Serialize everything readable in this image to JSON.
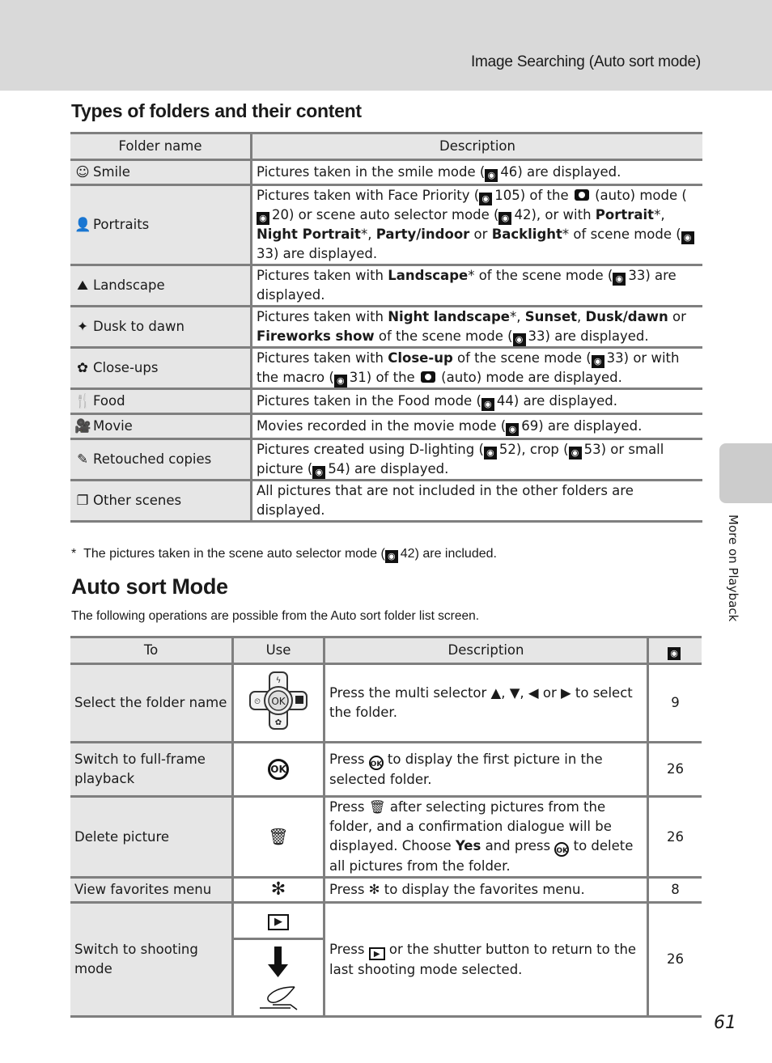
{
  "header": {
    "running_title": "Image Searching (Auto sort mode)"
  },
  "side_tab": {
    "label": "More on Playback"
  },
  "folders_section": {
    "title": "Types of folders and their content",
    "columns": [
      "Folder name",
      "Description"
    ],
    "rows": [
      {
        "icon": "smile-icon",
        "icon_glyph": "☺",
        "name": "Smile",
        "parts": [
          {
            "t": "Pictures taken in the smile mode ("
          },
          {
            "ref": "46"
          },
          {
            "t": ") are displayed."
          }
        ]
      },
      {
        "icon": "portrait-icon",
        "icon_glyph": "👤",
        "name": "Portraits",
        "parts": [
          {
            "t": "Pictures taken with Face Priority ("
          },
          {
            "ref": "105"
          },
          {
            "t": ") of the "
          },
          {
            "cam": true
          },
          {
            "t": " (auto) mode ("
          },
          {
            "ref": "20"
          },
          {
            "t": ") or scene auto selector mode ("
          },
          {
            "ref": "42"
          },
          {
            "t": "), or with "
          },
          {
            "b": "Portrait"
          },
          {
            "t": "*, "
          },
          {
            "b": "Night Portrait"
          },
          {
            "t": "*, "
          },
          {
            "b": "Party/indoor"
          },
          {
            "t": " or "
          },
          {
            "b": "Backlight"
          },
          {
            "t": "* of scene mode ("
          },
          {
            "ref": "33"
          },
          {
            "t": ") are displayed."
          }
        ]
      },
      {
        "icon": "landscape-icon",
        "icon_glyph": "⛰",
        "name": "Landscape",
        "parts": [
          {
            "t": "Pictures taken with "
          },
          {
            "b": "Landscape"
          },
          {
            "t": "* of the scene mode ("
          },
          {
            "ref": "33"
          },
          {
            "t": ") are displayed."
          }
        ]
      },
      {
        "icon": "dusk-to-dawn-icon",
        "icon_glyph": "✦",
        "name": "Dusk to dawn",
        "parts": [
          {
            "t": "Pictures taken with "
          },
          {
            "b": "Night landscape"
          },
          {
            "t": "*, "
          },
          {
            "b": "Sunset"
          },
          {
            "t": ", "
          },
          {
            "b": "Dusk/dawn"
          },
          {
            "t": " or "
          },
          {
            "b": "Fireworks show"
          },
          {
            "t": " of the scene mode ("
          },
          {
            "ref": "33"
          },
          {
            "t": ") are displayed."
          }
        ]
      },
      {
        "icon": "close-up-icon",
        "icon_glyph": "✿",
        "name": "Close-ups",
        "parts": [
          {
            "t": "Pictures taken with "
          },
          {
            "b": "Close-up"
          },
          {
            "t": " of the scene mode ("
          },
          {
            "ref": "33"
          },
          {
            "t": ") or with the macro ("
          },
          {
            "ref": "31"
          },
          {
            "t": ") of the "
          },
          {
            "cam": true
          },
          {
            "t": " (auto) mode are displayed."
          }
        ]
      },
      {
        "icon": "food-icon",
        "icon_glyph": "🍴",
        "name": "Food",
        "parts": [
          {
            "t": "Pictures taken in the Food mode ("
          },
          {
            "ref": "44"
          },
          {
            "t": ") are displayed."
          }
        ]
      },
      {
        "icon": "movie-icon",
        "icon_glyph": "🎥",
        "name": "Movie",
        "parts": [
          {
            "t": "Movies recorded in the movie mode ("
          },
          {
            "ref": "69"
          },
          {
            "t": ") are displayed."
          }
        ]
      },
      {
        "icon": "retouch-icon",
        "icon_glyph": "✎",
        "name": "Retouched copies",
        "parts": [
          {
            "t": "Pictures created using D-lighting ("
          },
          {
            "ref": "52"
          },
          {
            "t": "), crop ("
          },
          {
            "ref": "53"
          },
          {
            "t": ") or small picture ("
          },
          {
            "ref": "54"
          },
          {
            "t": ") are displayed."
          }
        ]
      },
      {
        "icon": "other-scenes-icon",
        "icon_glyph": "❐",
        "name": "Other scenes",
        "parts": [
          {
            "t": "All pictures that are not included in the other folders are displayed."
          }
        ]
      }
    ],
    "footnote_mark": "*",
    "footnote_parts": [
      {
        "t": "The pictures taken in the scene auto selector mode ("
      },
      {
        "ref": "42"
      },
      {
        "t": ") are included."
      }
    ]
  },
  "auto_sort_section": {
    "title": "Auto sort Mode",
    "intro": "The following operations are possible from the Auto sort folder list screen.",
    "columns": [
      "To",
      "Use",
      "Description"
    ],
    "ref_column_icon": "reference-icon",
    "rows": [
      {
        "to": "Select the folder name",
        "use": "multi-selector-icon",
        "parts": [
          {
            "t": "Press the multi selector ▲, ▼, ◀ or ▶ to select the folder."
          }
        ],
        "page": "9"
      },
      {
        "to": "Switch to full-frame playback",
        "use": "ok-button-icon",
        "parts": [
          {
            "t": "Press "
          },
          {
            "ok": true
          },
          {
            "t": " to display the first picture in the selected folder."
          }
        ],
        "page": "26"
      },
      {
        "to": "Delete picture",
        "use": "trash-icon",
        "parts": [
          {
            "t": "Press "
          },
          {
            "trash": true
          },
          {
            "t": " after selecting pictures from the folder, and a confirmation dialogue will be displayed. Choose "
          },
          {
            "b": "Yes"
          },
          {
            "t": " and press "
          },
          {
            "ok": true
          },
          {
            "t": " to delete all pictures from the folder."
          }
        ],
        "page": "26"
      },
      {
        "to": "View favorites menu",
        "use": "favorites-icon",
        "parts": [
          {
            "t": "Press "
          },
          {
            "fav": true
          },
          {
            "t": " to display the favorites menu."
          }
        ],
        "page": "8"
      },
      {
        "to": "Switch to shooting mode",
        "use": [
          "playback-button-icon",
          "shutter-button-icon"
        ],
        "parts": [
          {
            "t": "Press "
          },
          {
            "play": true
          },
          {
            "t": " or the shutter button to return to the last shooting mode selected."
          }
        ],
        "page": "26"
      }
    ]
  },
  "page_number": "61"
}
